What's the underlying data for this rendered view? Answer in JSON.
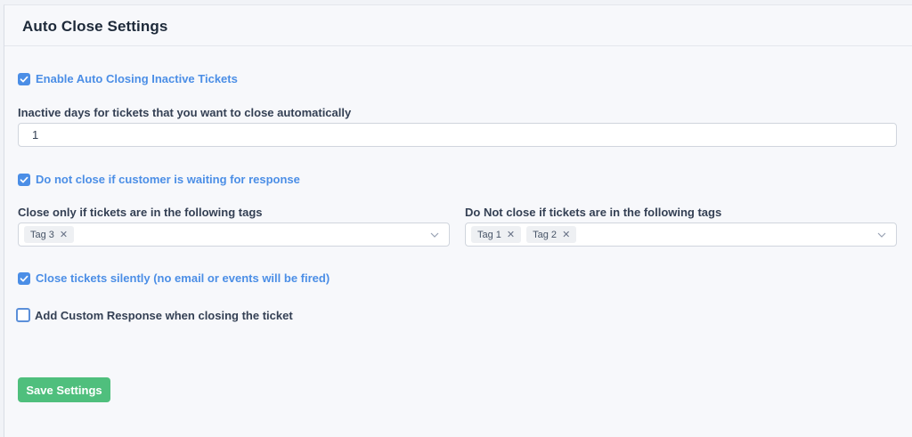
{
  "header": {
    "title": "Auto Close Settings"
  },
  "settings": {
    "enable_auto_close": {
      "label": "Enable Auto Closing Inactive Tickets",
      "checked": true
    },
    "inactive_days": {
      "label": "Inactive days for tickets that you want to close automatically",
      "value": "1"
    },
    "wait_for_response": {
      "label": "Do not close if customer is waiting for response",
      "checked": true
    },
    "include_tags": {
      "label": "Close only if tickets are in the following tags",
      "tags": [
        "Tag 3"
      ]
    },
    "exclude_tags": {
      "label": "Do Not close if tickets are in the following tags",
      "tags": [
        "Tag 1",
        "Tag 2"
      ]
    },
    "close_silently": {
      "label": "Close tickets silently (no email or events will be fired)",
      "checked": true
    },
    "custom_response": {
      "label": "Add Custom Response when closing the ticket",
      "checked": false
    }
  },
  "actions": {
    "save_label": "Save Settings"
  },
  "colors": {
    "accent": "#4b8ee6",
    "save_button": "#4fbf7d"
  },
  "icons": {
    "checkmark": "check-icon",
    "remove_tag": "close-icon",
    "dropdown": "chevron-down-icon"
  }
}
